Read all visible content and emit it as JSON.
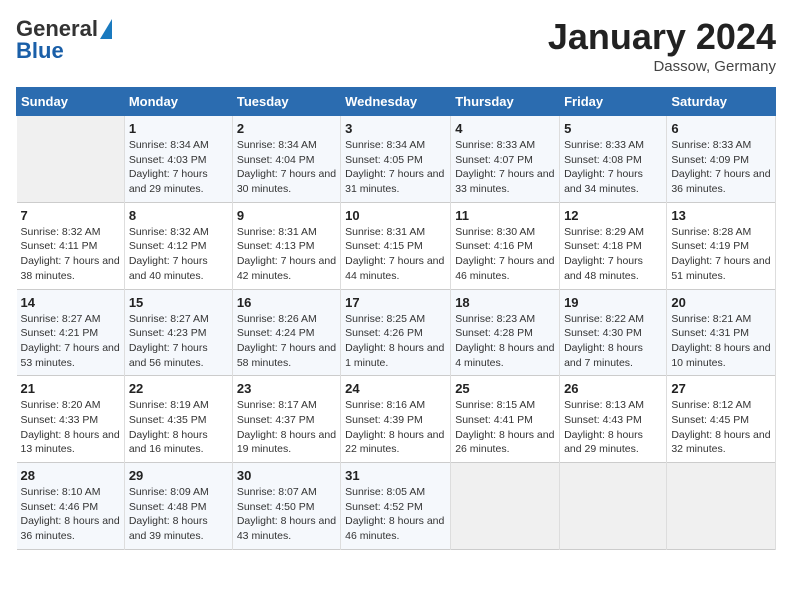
{
  "header": {
    "logo_line1": "General",
    "logo_line2": "Blue",
    "month_title": "January 2024",
    "location": "Dassow, Germany"
  },
  "weekdays": [
    "Sunday",
    "Monday",
    "Tuesday",
    "Wednesday",
    "Thursday",
    "Friday",
    "Saturday"
  ],
  "weeks": [
    [
      {
        "day": "",
        "sunrise": "",
        "sunset": "",
        "daylight": ""
      },
      {
        "day": "1",
        "sunrise": "Sunrise: 8:34 AM",
        "sunset": "Sunset: 4:03 PM",
        "daylight": "Daylight: 7 hours and 29 minutes."
      },
      {
        "day": "2",
        "sunrise": "Sunrise: 8:34 AM",
        "sunset": "Sunset: 4:04 PM",
        "daylight": "Daylight: 7 hours and 30 minutes."
      },
      {
        "day": "3",
        "sunrise": "Sunrise: 8:34 AM",
        "sunset": "Sunset: 4:05 PM",
        "daylight": "Daylight: 7 hours and 31 minutes."
      },
      {
        "day": "4",
        "sunrise": "Sunrise: 8:33 AM",
        "sunset": "Sunset: 4:07 PM",
        "daylight": "Daylight: 7 hours and 33 minutes."
      },
      {
        "day": "5",
        "sunrise": "Sunrise: 8:33 AM",
        "sunset": "Sunset: 4:08 PM",
        "daylight": "Daylight: 7 hours and 34 minutes."
      },
      {
        "day": "6",
        "sunrise": "Sunrise: 8:33 AM",
        "sunset": "Sunset: 4:09 PM",
        "daylight": "Daylight: 7 hours and 36 minutes."
      }
    ],
    [
      {
        "day": "7",
        "sunrise": "Sunrise: 8:32 AM",
        "sunset": "Sunset: 4:11 PM",
        "daylight": "Daylight: 7 hours and 38 minutes."
      },
      {
        "day": "8",
        "sunrise": "Sunrise: 8:32 AM",
        "sunset": "Sunset: 4:12 PM",
        "daylight": "Daylight: 7 hours and 40 minutes."
      },
      {
        "day": "9",
        "sunrise": "Sunrise: 8:31 AM",
        "sunset": "Sunset: 4:13 PM",
        "daylight": "Daylight: 7 hours and 42 minutes."
      },
      {
        "day": "10",
        "sunrise": "Sunrise: 8:31 AM",
        "sunset": "Sunset: 4:15 PM",
        "daylight": "Daylight: 7 hours and 44 minutes."
      },
      {
        "day": "11",
        "sunrise": "Sunrise: 8:30 AM",
        "sunset": "Sunset: 4:16 PM",
        "daylight": "Daylight: 7 hours and 46 minutes."
      },
      {
        "day": "12",
        "sunrise": "Sunrise: 8:29 AM",
        "sunset": "Sunset: 4:18 PM",
        "daylight": "Daylight: 7 hours and 48 minutes."
      },
      {
        "day": "13",
        "sunrise": "Sunrise: 8:28 AM",
        "sunset": "Sunset: 4:19 PM",
        "daylight": "Daylight: 7 hours and 51 minutes."
      }
    ],
    [
      {
        "day": "14",
        "sunrise": "Sunrise: 8:27 AM",
        "sunset": "Sunset: 4:21 PM",
        "daylight": "Daylight: 7 hours and 53 minutes."
      },
      {
        "day": "15",
        "sunrise": "Sunrise: 8:27 AM",
        "sunset": "Sunset: 4:23 PM",
        "daylight": "Daylight: 7 hours and 56 minutes."
      },
      {
        "day": "16",
        "sunrise": "Sunrise: 8:26 AM",
        "sunset": "Sunset: 4:24 PM",
        "daylight": "Daylight: 7 hours and 58 minutes."
      },
      {
        "day": "17",
        "sunrise": "Sunrise: 8:25 AM",
        "sunset": "Sunset: 4:26 PM",
        "daylight": "Daylight: 8 hours and 1 minute."
      },
      {
        "day": "18",
        "sunrise": "Sunrise: 8:23 AM",
        "sunset": "Sunset: 4:28 PM",
        "daylight": "Daylight: 8 hours and 4 minutes."
      },
      {
        "day": "19",
        "sunrise": "Sunrise: 8:22 AM",
        "sunset": "Sunset: 4:30 PM",
        "daylight": "Daylight: 8 hours and 7 minutes."
      },
      {
        "day": "20",
        "sunrise": "Sunrise: 8:21 AM",
        "sunset": "Sunset: 4:31 PM",
        "daylight": "Daylight: 8 hours and 10 minutes."
      }
    ],
    [
      {
        "day": "21",
        "sunrise": "Sunrise: 8:20 AM",
        "sunset": "Sunset: 4:33 PM",
        "daylight": "Daylight: 8 hours and 13 minutes."
      },
      {
        "day": "22",
        "sunrise": "Sunrise: 8:19 AM",
        "sunset": "Sunset: 4:35 PM",
        "daylight": "Daylight: 8 hours and 16 minutes."
      },
      {
        "day": "23",
        "sunrise": "Sunrise: 8:17 AM",
        "sunset": "Sunset: 4:37 PM",
        "daylight": "Daylight: 8 hours and 19 minutes."
      },
      {
        "day": "24",
        "sunrise": "Sunrise: 8:16 AM",
        "sunset": "Sunset: 4:39 PM",
        "daylight": "Daylight: 8 hours and 22 minutes."
      },
      {
        "day": "25",
        "sunrise": "Sunrise: 8:15 AM",
        "sunset": "Sunset: 4:41 PM",
        "daylight": "Daylight: 8 hours and 26 minutes."
      },
      {
        "day": "26",
        "sunrise": "Sunrise: 8:13 AM",
        "sunset": "Sunset: 4:43 PM",
        "daylight": "Daylight: 8 hours and 29 minutes."
      },
      {
        "day": "27",
        "sunrise": "Sunrise: 8:12 AM",
        "sunset": "Sunset: 4:45 PM",
        "daylight": "Daylight: 8 hours and 32 minutes."
      }
    ],
    [
      {
        "day": "28",
        "sunrise": "Sunrise: 8:10 AM",
        "sunset": "Sunset: 4:46 PM",
        "daylight": "Daylight: 8 hours and 36 minutes."
      },
      {
        "day": "29",
        "sunrise": "Sunrise: 8:09 AM",
        "sunset": "Sunset: 4:48 PM",
        "daylight": "Daylight: 8 hours and 39 minutes."
      },
      {
        "day": "30",
        "sunrise": "Sunrise: 8:07 AM",
        "sunset": "Sunset: 4:50 PM",
        "daylight": "Daylight: 8 hours and 43 minutes."
      },
      {
        "day": "31",
        "sunrise": "Sunrise: 8:05 AM",
        "sunset": "Sunset: 4:52 PM",
        "daylight": "Daylight: 8 hours and 46 minutes."
      },
      {
        "day": "",
        "sunrise": "",
        "sunset": "",
        "daylight": ""
      },
      {
        "day": "",
        "sunrise": "",
        "sunset": "",
        "daylight": ""
      },
      {
        "day": "",
        "sunrise": "",
        "sunset": "",
        "daylight": ""
      }
    ]
  ]
}
